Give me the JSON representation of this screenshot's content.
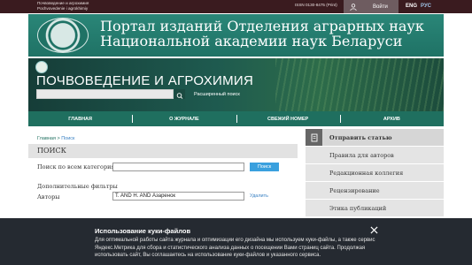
{
  "topbar": {
    "journal_line1": "Почвоведение и агрохимия",
    "journal_line2": "Pochvovedenie i agrokhimiy",
    "issn": "ISSN 0130-8475 (Print)",
    "login_label": "Войти",
    "lang_en": "ENG",
    "lang_ru": "РУС"
  },
  "banner": {
    "title_line1": "Портал изданий Отделения аграрных наук",
    "title_line2": "Национальной академии наук Беларуси"
  },
  "journal": {
    "title": "ПОЧВОВЕДЕНИЕ И АГРОХИМИЯ",
    "search_value": "",
    "advanced_search": "Расширенный поиск"
  },
  "nav": {
    "items": [
      {
        "label": "ГЛАВНАЯ"
      },
      {
        "label": "О ЖУРНАЛЕ"
      },
      {
        "label": "СВЕЖИЙ НОМЕР"
      },
      {
        "label": "АРХИВ"
      }
    ]
  },
  "breadcrumb": {
    "home": "Главная",
    "separator": ">",
    "current": "Поиск"
  },
  "search": {
    "panel_title": "ПОИСК",
    "all_categories_label": "Поиск по всем категориям",
    "all_categories_value": "",
    "search_button": "Поиск",
    "extra_filters_label": "Дополнительные фильтры",
    "authors_label": "Авторы",
    "authors_value": "T. AND H. AND Азаренок",
    "delete_link": "Удалить"
  },
  "sidebar": {
    "items": [
      {
        "label": "Отправить статью"
      },
      {
        "label": "Правила для авторов"
      },
      {
        "label": "Редакционная коллегия"
      },
      {
        "label": "Рецензирование"
      },
      {
        "label": "Этика публикаций"
      }
    ]
  },
  "cookie": {
    "title": "Использование куки-файлов",
    "body": "Для оптимальной работы сайта журнала и оптимизации его дизайна мы используем куки-файлы, а также сервис Яндекс.Метрика для сбора и статистического анализа данных о посещении Вами страниц сайта. Продолжая использовать сайт, Вы соглашаетесь на использование куки-файлов и указанного сервиса."
  },
  "colors": {
    "topbar": "#3a1b1f",
    "banner": "#2a8678",
    "nav": "#1f6f5f",
    "link": "#3b82c4",
    "button": "#3aa0de",
    "cookie_bg": "#252a31"
  }
}
